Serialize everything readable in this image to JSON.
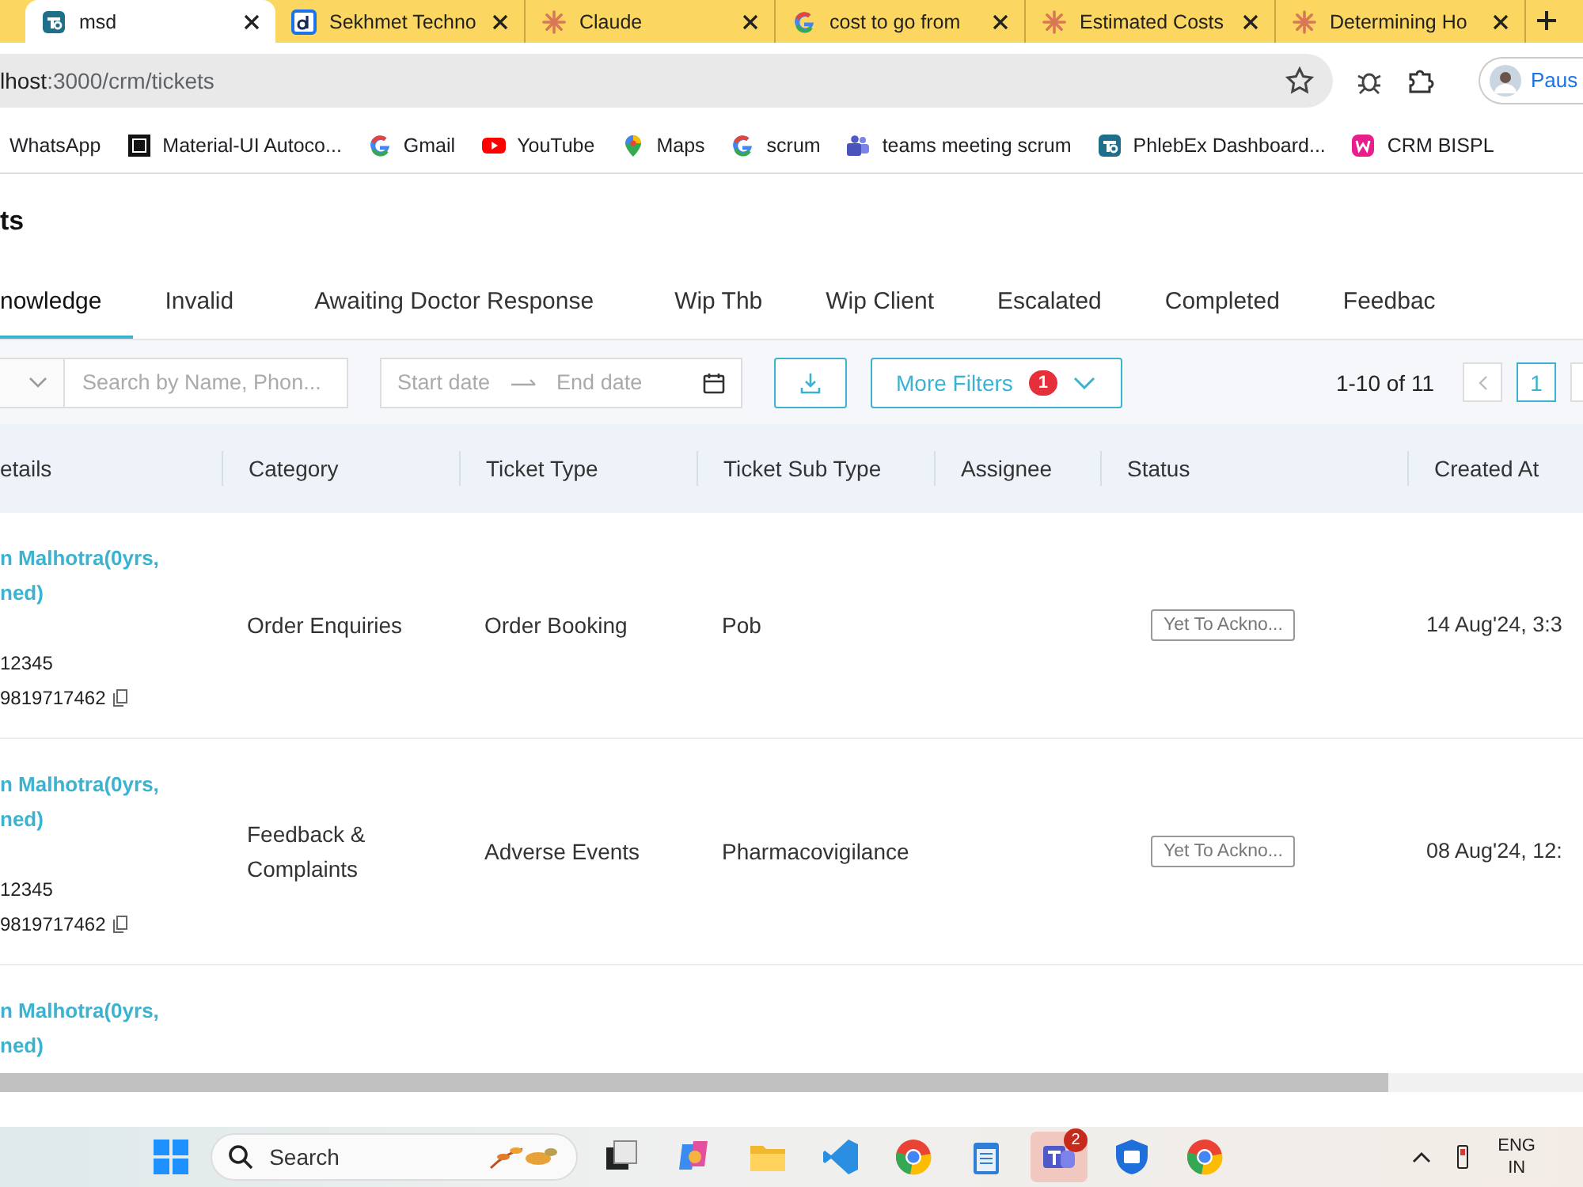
{
  "browser": {
    "tabs": [
      {
        "title": "msd",
        "selected": true
      },
      {
        "title": "Sekhmet Techno",
        "selected": false
      },
      {
        "title": "Claude",
        "selected": false
      },
      {
        "title": "cost to go from",
        "selected": false
      },
      {
        "title": "Estimated Costs",
        "selected": false
      },
      {
        "title": "Determining Ho",
        "selected": false
      }
    ],
    "address": "lhost:3000/crm/tickets",
    "profile_label": "Paus",
    "bookmarks": [
      {
        "label": "WhatsApp"
      },
      {
        "label": "Material-UI Autoco..."
      },
      {
        "label": "Gmail"
      },
      {
        "label": "YouTube"
      },
      {
        "label": "Maps"
      },
      {
        "label": "scrum"
      },
      {
        "label": "teams meeting scrum"
      },
      {
        "label": "PhlebEx Dashboard..."
      },
      {
        "label": "CRM BISPL"
      }
    ]
  },
  "page": {
    "title": "ts",
    "status_tabs": [
      {
        "label": "nowledge",
        "selected": true
      },
      {
        "label": "Invalid",
        "selected": false
      },
      {
        "label": "Awaiting Doctor Response",
        "selected": false
      },
      {
        "label": "Wip Thb",
        "selected": false
      },
      {
        "label": "Wip Client",
        "selected": false
      },
      {
        "label": "Escalated",
        "selected": false
      },
      {
        "label": "Completed",
        "selected": false
      },
      {
        "label": "Feedbac",
        "selected": false
      }
    ],
    "filters": {
      "search_placeholder": "Search by Name, Phon...",
      "start_date_placeholder": "Start date",
      "end_date_placeholder": "End date",
      "more_filters": "More Filters",
      "filter_count": "1",
      "pagination_summary": "1-10 of 11",
      "current_page": "1"
    },
    "table": {
      "columns": [
        "etails",
        "Category",
        "Ticket Type",
        "Ticket Sub Type",
        "Assignee",
        "Status",
        "Created At"
      ],
      "rows": [
        {
          "details": [
            {
              "text": "n Malhotra(0yrs,",
              "kind": "link"
            },
            {
              "text": "ned)",
              "kind": "link"
            },
            {
              "text": "12345",
              "kind": "plain"
            },
            {
              "text": "9819717462",
              "kind": "phone"
            }
          ],
          "category": "Order Enquiries",
          "ticket_type": "Order Booking",
          "ticket_sub_type": "Pob",
          "status": "Yet To Ackno...",
          "created_at": "14 Aug'24, 3:3"
        },
        {
          "details": [
            {
              "text": "n Malhotra(0yrs,",
              "kind": "link"
            },
            {
              "text": "ned)",
              "kind": "link"
            },
            {
              "text": "12345",
              "kind": "plain"
            },
            {
              "text": "9819717462",
              "kind": "phone"
            }
          ],
          "category": "Feedback & Complaints",
          "ticket_type": "Adverse Events",
          "ticket_sub_type": "Pharmacovigilance",
          "status": "Yet To Ackno...",
          "created_at": "08 Aug'24, 12:"
        },
        {
          "details": [
            {
              "text": "n Malhotra(0yrs,",
              "kind": "link"
            },
            {
              "text": "ned)",
              "kind": "link"
            }
          ]
        }
      ]
    }
  },
  "taskbar": {
    "search_placeholder": "Search",
    "teams_badge": "2",
    "language": "ENG",
    "region": "IN"
  }
}
